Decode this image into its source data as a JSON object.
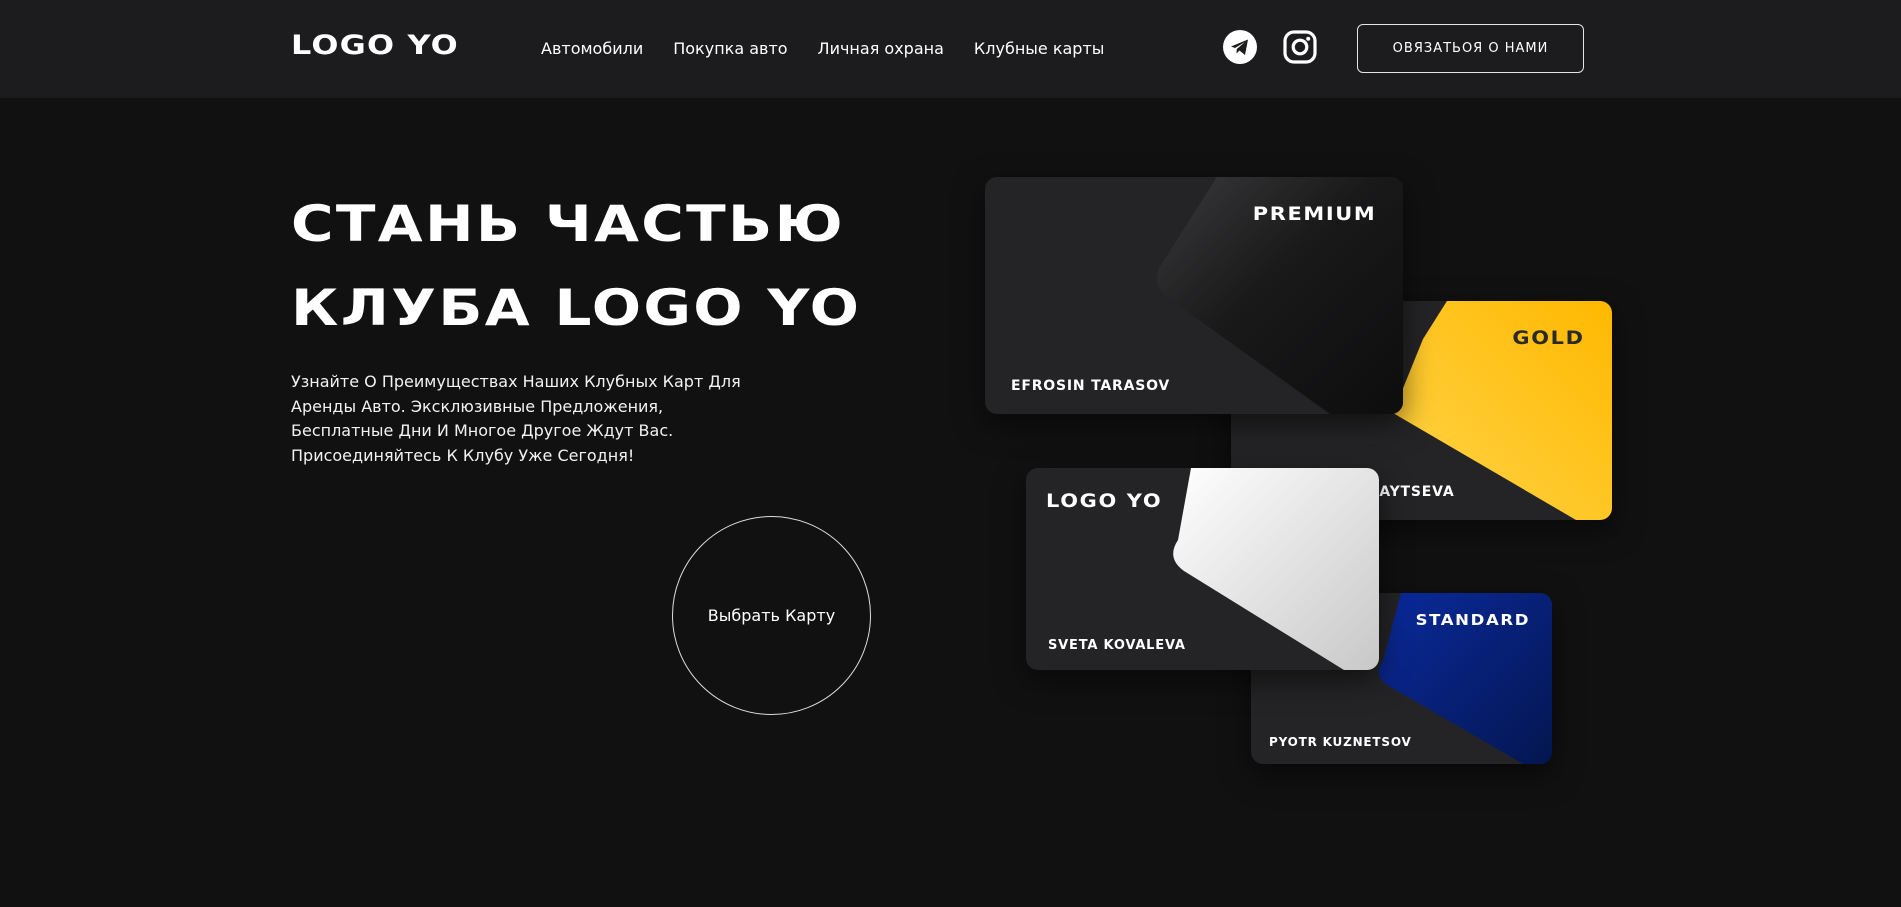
{
  "header": {
    "logo": "LOGO YO",
    "nav": [
      "Автомобили",
      "Покупка авто",
      "Личная охрана",
      "Клубные карты"
    ],
    "social_icons": [
      "telegram-icon",
      "instagram-icon"
    ],
    "contact_button": "ОВЯЗАТЬОЯ О НАМИ"
  },
  "hero": {
    "title_line1": "СТАНЬ ЧАСТЬЮ",
    "title_line2": "КЛУБА LOGO YO",
    "subtitle_lines": [
      "Узнайте О Преимуществах Наших Клубных Карт Для",
      "Аренды Авто. Эксклюзивные Предложения,",
      "Бесплатные Дни И Многое Другое Ждут Вас.",
      "Присоединяйтесь К Клубу Уже Сегодня!"
    ],
    "choose_button": "Выбрать Карту"
  },
  "cards": {
    "premium": {
      "tier": "PREMIUM",
      "holder": "EFROSIN TARASOV"
    },
    "gold": {
      "tier": "GOLD",
      "holder": "ANASTASIYA ZAYTSEVA",
      "accent": "#FFC21A"
    },
    "logoyo": {
      "tier": "LOGO YO",
      "holder": "SVETA KOVALEVA"
    },
    "standard": {
      "tier": "STANDARD",
      "holder": "PYOTR KUZNETSOV",
      "accent": "#0A2A8C"
    }
  },
  "colors": {
    "background": "#111112",
    "header": "#1C1C1E",
    "card": "#242426"
  }
}
